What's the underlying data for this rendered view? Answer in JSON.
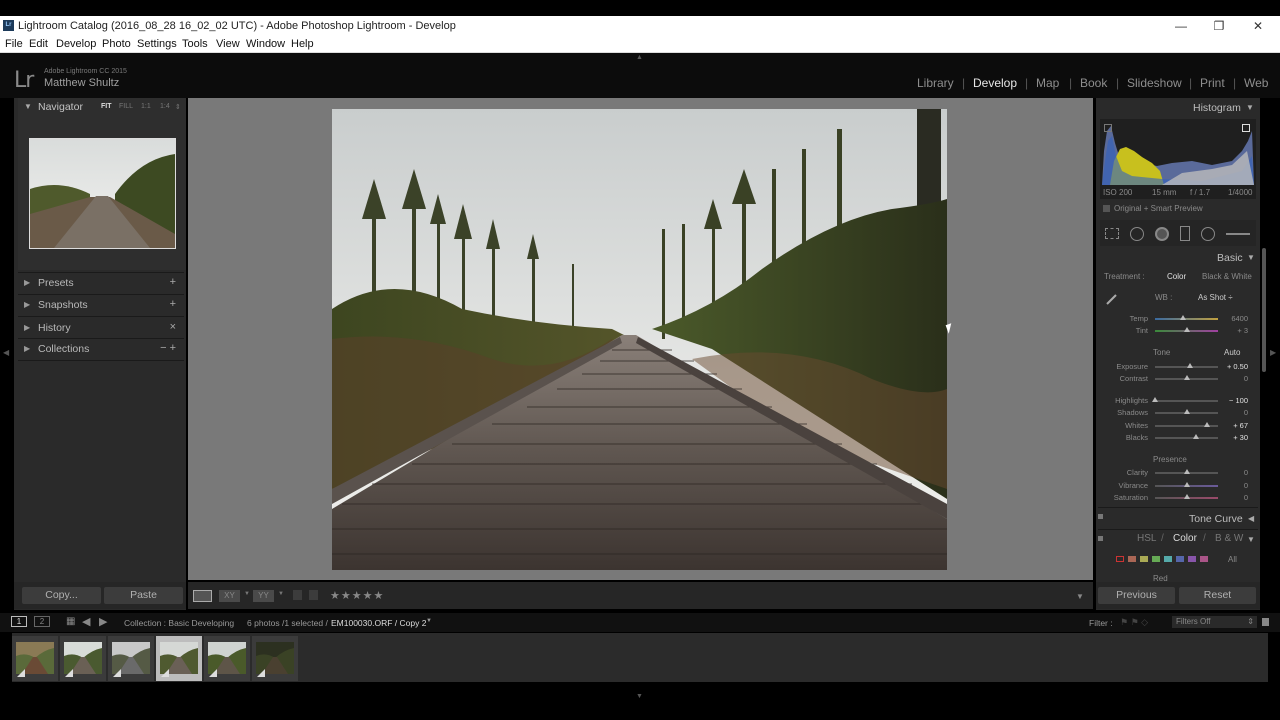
{
  "window": {
    "title": "Lightroom Catalog (2016_08_28 16_02_02 UTC) - Adobe Photoshop Lightroom - Develop",
    "app_icon": "Lr",
    "minimize": "—",
    "restore": "❐",
    "close": "✕"
  },
  "menu": [
    "File",
    "Edit",
    "Develop",
    "Photo",
    "Settings",
    "Tools",
    "View",
    "Window",
    "Help"
  ],
  "identity": {
    "logo": "Lr",
    "product": "Adobe Lightroom CC 2015",
    "user": "Matthew Shultz"
  },
  "modules": [
    "Library",
    "Develop",
    "Map",
    "Book",
    "Slideshow",
    "Print",
    "Web"
  ],
  "active_module": "Develop",
  "left_panel": {
    "navigator": {
      "title": "Navigator",
      "options": [
        "FIT",
        "FILL",
        "1:1",
        "1:4"
      ],
      "selected_option": "FIT"
    },
    "sections": [
      {
        "label": "Presets",
        "action": "+"
      },
      {
        "label": "Snapshots",
        "action": "+"
      },
      {
        "label": "History",
        "action": "×"
      },
      {
        "label": "Collections",
        "action": "− +"
      }
    ],
    "copy_button": "Copy...",
    "paste_button": "Paste"
  },
  "toolbar": {
    "rating": "★★★★★"
  },
  "right_panel": {
    "histogram": {
      "title": "Histogram",
      "iso": "ISO 200",
      "focal": "15 mm",
      "aperture": "f / 1.7",
      "shutter": "1/4000",
      "preview": "Original + Smart Preview"
    },
    "basic": {
      "title": "Basic",
      "treatment_label": "Treatment :",
      "treatment_color": "Color",
      "treatment_bw": "Black & White",
      "wb_label": "WB :",
      "wb_value": "As Shot ÷",
      "tone_label": "Tone",
      "auto_label": "Auto",
      "presence_label": "Presence",
      "sliders": [
        {
          "label": "Temp",
          "value": "6400",
          "pos": 0.45
        },
        {
          "label": "Tint",
          "value": "+ 3",
          "pos": 0.5
        },
        {
          "label": "Exposure",
          "value": "+ 0.50",
          "pos": 0.55,
          "bright": true
        },
        {
          "label": "Contrast",
          "value": "0",
          "pos": 0.5
        },
        {
          "label": "Highlights",
          "value": "− 100",
          "pos": 0.0,
          "bright": true
        },
        {
          "label": "Shadows",
          "value": "0",
          "pos": 0.5
        },
        {
          "label": "Whites",
          "value": "+ 67",
          "pos": 0.83,
          "bright": true
        },
        {
          "label": "Blacks",
          "value": "+ 30",
          "pos": 0.65,
          "bright": true
        },
        {
          "label": "Clarity",
          "value": "0",
          "pos": 0.5
        },
        {
          "label": "Vibrance",
          "value": "0",
          "pos": 0.5
        },
        {
          "label": "Saturation",
          "value": "0",
          "pos": 0.5
        }
      ]
    },
    "tone_curve": "Tone Curve",
    "hsl": {
      "hsl": "HSL",
      "sep1": "/",
      "color": "Color",
      "sep2": "/",
      "bw": "B & W",
      "all": "All",
      "red": "Red"
    },
    "previous_button": "Previous",
    "reset_button": "Reset"
  },
  "filmstrip": {
    "screen1": "1",
    "screen2": "2",
    "source": "Collection : Basic Developing",
    "count": "6 photos /1 selected /",
    "filename": "EM100030.ORF / Copy 2",
    "filter_label": "Filter :",
    "filter_value": "Filters Off",
    "thumbs": 6,
    "selected_index": 3
  }
}
